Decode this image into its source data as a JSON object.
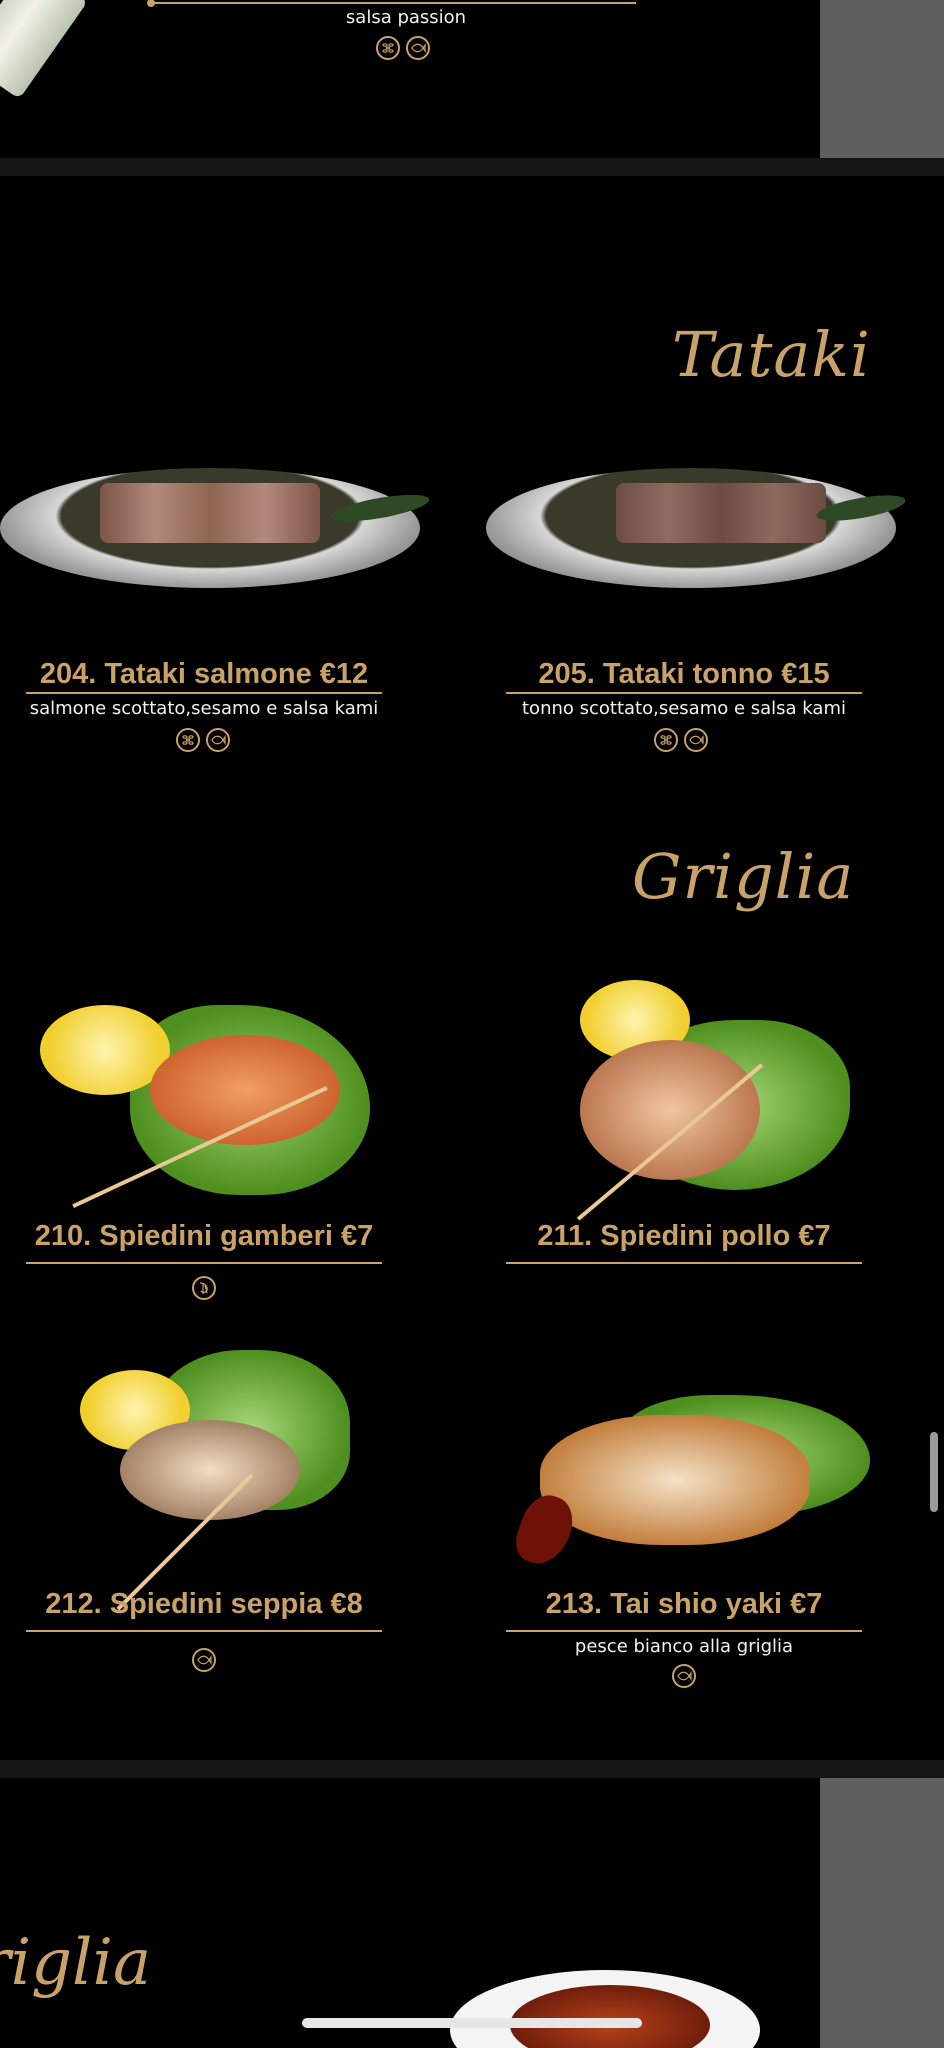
{
  "top": {
    "desc": "salsa passion",
    "icons": [
      "sesame-icon",
      "fish-icon"
    ]
  },
  "tataki": {
    "title": "Tataki",
    "items": [
      {
        "name": "204. Tataki salmone €12",
        "desc": "salmone scottato,sesamo e salsa kami",
        "icons": [
          "sesame-icon",
          "fish-icon"
        ]
      },
      {
        "name": "205. Tataki tonno €15",
        "desc": "tonno scottato,sesamo e salsa kami",
        "icons": [
          "sesame-icon",
          "fish-icon"
        ]
      }
    ]
  },
  "griglia": {
    "title": "Griglia",
    "items": [
      {
        "name": "210. Spiedini gamberi €7",
        "desc": "",
        "icons": [
          "shrimp-icon"
        ]
      },
      {
        "name": "211. Spiedini pollo €7",
        "desc": "",
        "icons": []
      },
      {
        "name": "212. Spiedini seppia €8",
        "desc": "",
        "icons": [
          "fish-icon"
        ]
      },
      {
        "name": "213. Tai shio yaki €7",
        "desc": "pesce bianco alla griglia",
        "icons": [
          "fish-icon"
        ]
      }
    ]
  },
  "next_page": {
    "title": "riglia"
  },
  "colors": {
    "accent": "#c9a26a",
    "background": "#000000",
    "side_gray": "#5f5f5f"
  }
}
